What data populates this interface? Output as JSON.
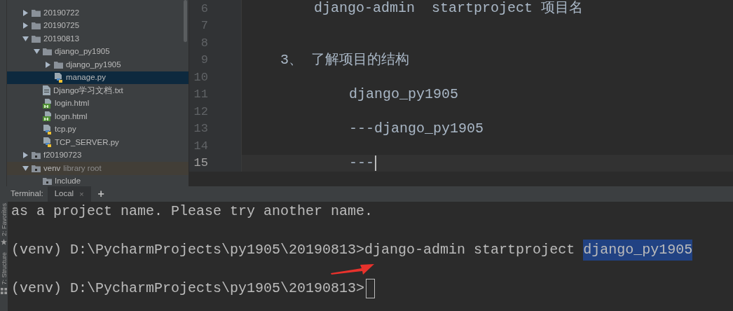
{
  "project_tree": {
    "items": [
      {
        "label": "20190722",
        "kind": "folder",
        "expanded": false,
        "selected": false
      },
      {
        "label": "20190725",
        "kind": "folder",
        "expanded": false,
        "selected": false
      },
      {
        "label": "20190813",
        "kind": "folder",
        "expanded": true,
        "selected": false,
        "children": [
          {
            "label": "django_py1905",
            "kind": "folder",
            "expanded": true,
            "selected": false,
            "children": [
              {
                "label": "django_py1905",
                "kind": "folder",
                "expanded": false,
                "selected": false
              },
              {
                "label": "manage.py",
                "kind": "python",
                "selected": true
              }
            ]
          },
          {
            "label": "Django学习文档.txt",
            "kind": "text",
            "selected": false
          },
          {
            "label": "login.html",
            "kind": "html",
            "selected": false
          },
          {
            "label": "logn.html",
            "kind": "html",
            "selected": false
          },
          {
            "label": "tcp.py",
            "kind": "python",
            "selected": false
          },
          {
            "label": "TCP_SERVER.py",
            "kind": "python",
            "selected": false
          }
        ]
      },
      {
        "label": "f20190723",
        "kind": "module",
        "expanded": false,
        "selected": false
      },
      {
        "label": "venv",
        "note": "library root",
        "kind": "library",
        "expanded": true,
        "selected": false,
        "children": [
          {
            "label": "Include",
            "kind": "module",
            "selected": false
          }
        ]
      }
    ]
  },
  "editor": {
    "lines": [
      {
        "number": "6",
        "kind": "command",
        "text": "django-admin  startproject 项目名",
        "current": false
      },
      {
        "number": "7",
        "kind": "blank",
        "current": false
      },
      {
        "number": "8",
        "kind": "blank",
        "current": false
      },
      {
        "number": "9",
        "kind": "item",
        "text": "3、 了解项目的结构",
        "current": false
      },
      {
        "number": "10",
        "kind": "blank",
        "current": false
      },
      {
        "number": "11",
        "kind": "sub",
        "text": "django_py1905",
        "current": false
      },
      {
        "number": "12",
        "kind": "blank",
        "current": false
      },
      {
        "number": "13",
        "kind": "sub",
        "text": "---django_py1905",
        "current": false
      },
      {
        "number": "14",
        "kind": "blank",
        "current": false
      },
      {
        "number": "15",
        "kind": "sub",
        "text": "---",
        "current": true
      }
    ]
  },
  "terminal": {
    "title": "Terminal:",
    "tabs": [
      {
        "label": "Local",
        "close": "×",
        "selected": true
      }
    ],
    "add": "+",
    "tool_windows": [
      {
        "label": "2: Favorites",
        "kind": "star"
      },
      {
        "label": "7: Structure",
        "kind": "structure"
      }
    ],
    "lines": [
      {
        "text": "as a project name. Please try another name.",
        "cursor": false
      },
      {
        "text": "(venv) D:\\PycharmProjects\\py1905\\20190813>django-admin startproject ",
        "highlight": "django_py1905",
        "cursor": false
      },
      {
        "text": "(venv) D:\\PycharmProjects\\py1905\\20190813>",
        "cursor": true
      }
    ]
  }
}
